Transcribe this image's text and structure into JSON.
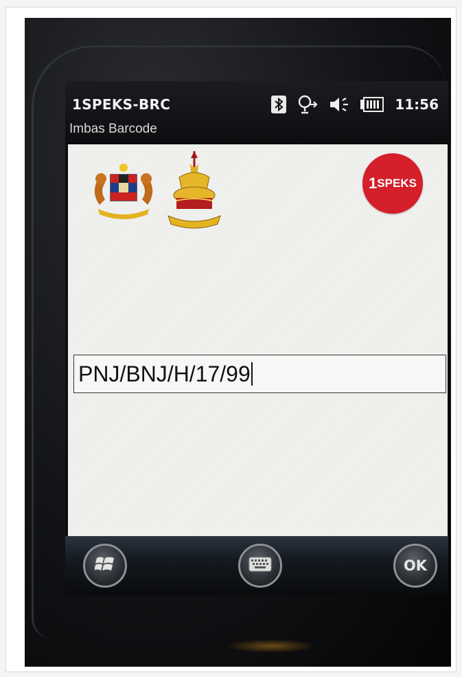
{
  "titlebar": {
    "app_title": "1SPEKS-BRC",
    "subtitle": "Imbas Barcode"
  },
  "status_bar": {
    "icons": [
      "bluetooth-icon",
      "connectivity-icon",
      "speaker-icon",
      "battery-icon"
    ],
    "time": "11:56"
  },
  "header": {
    "logo_text_prefix": "1",
    "logo_text": "SPEKS",
    "logo_color": "#d51f2a"
  },
  "form": {
    "barcode_value": "PNJ/BNJ/H/17/99"
  },
  "menubar": {
    "start_icon": "windows-logo-icon",
    "keyboard_icon": "keyboard-icon",
    "ok_label": "OK"
  }
}
